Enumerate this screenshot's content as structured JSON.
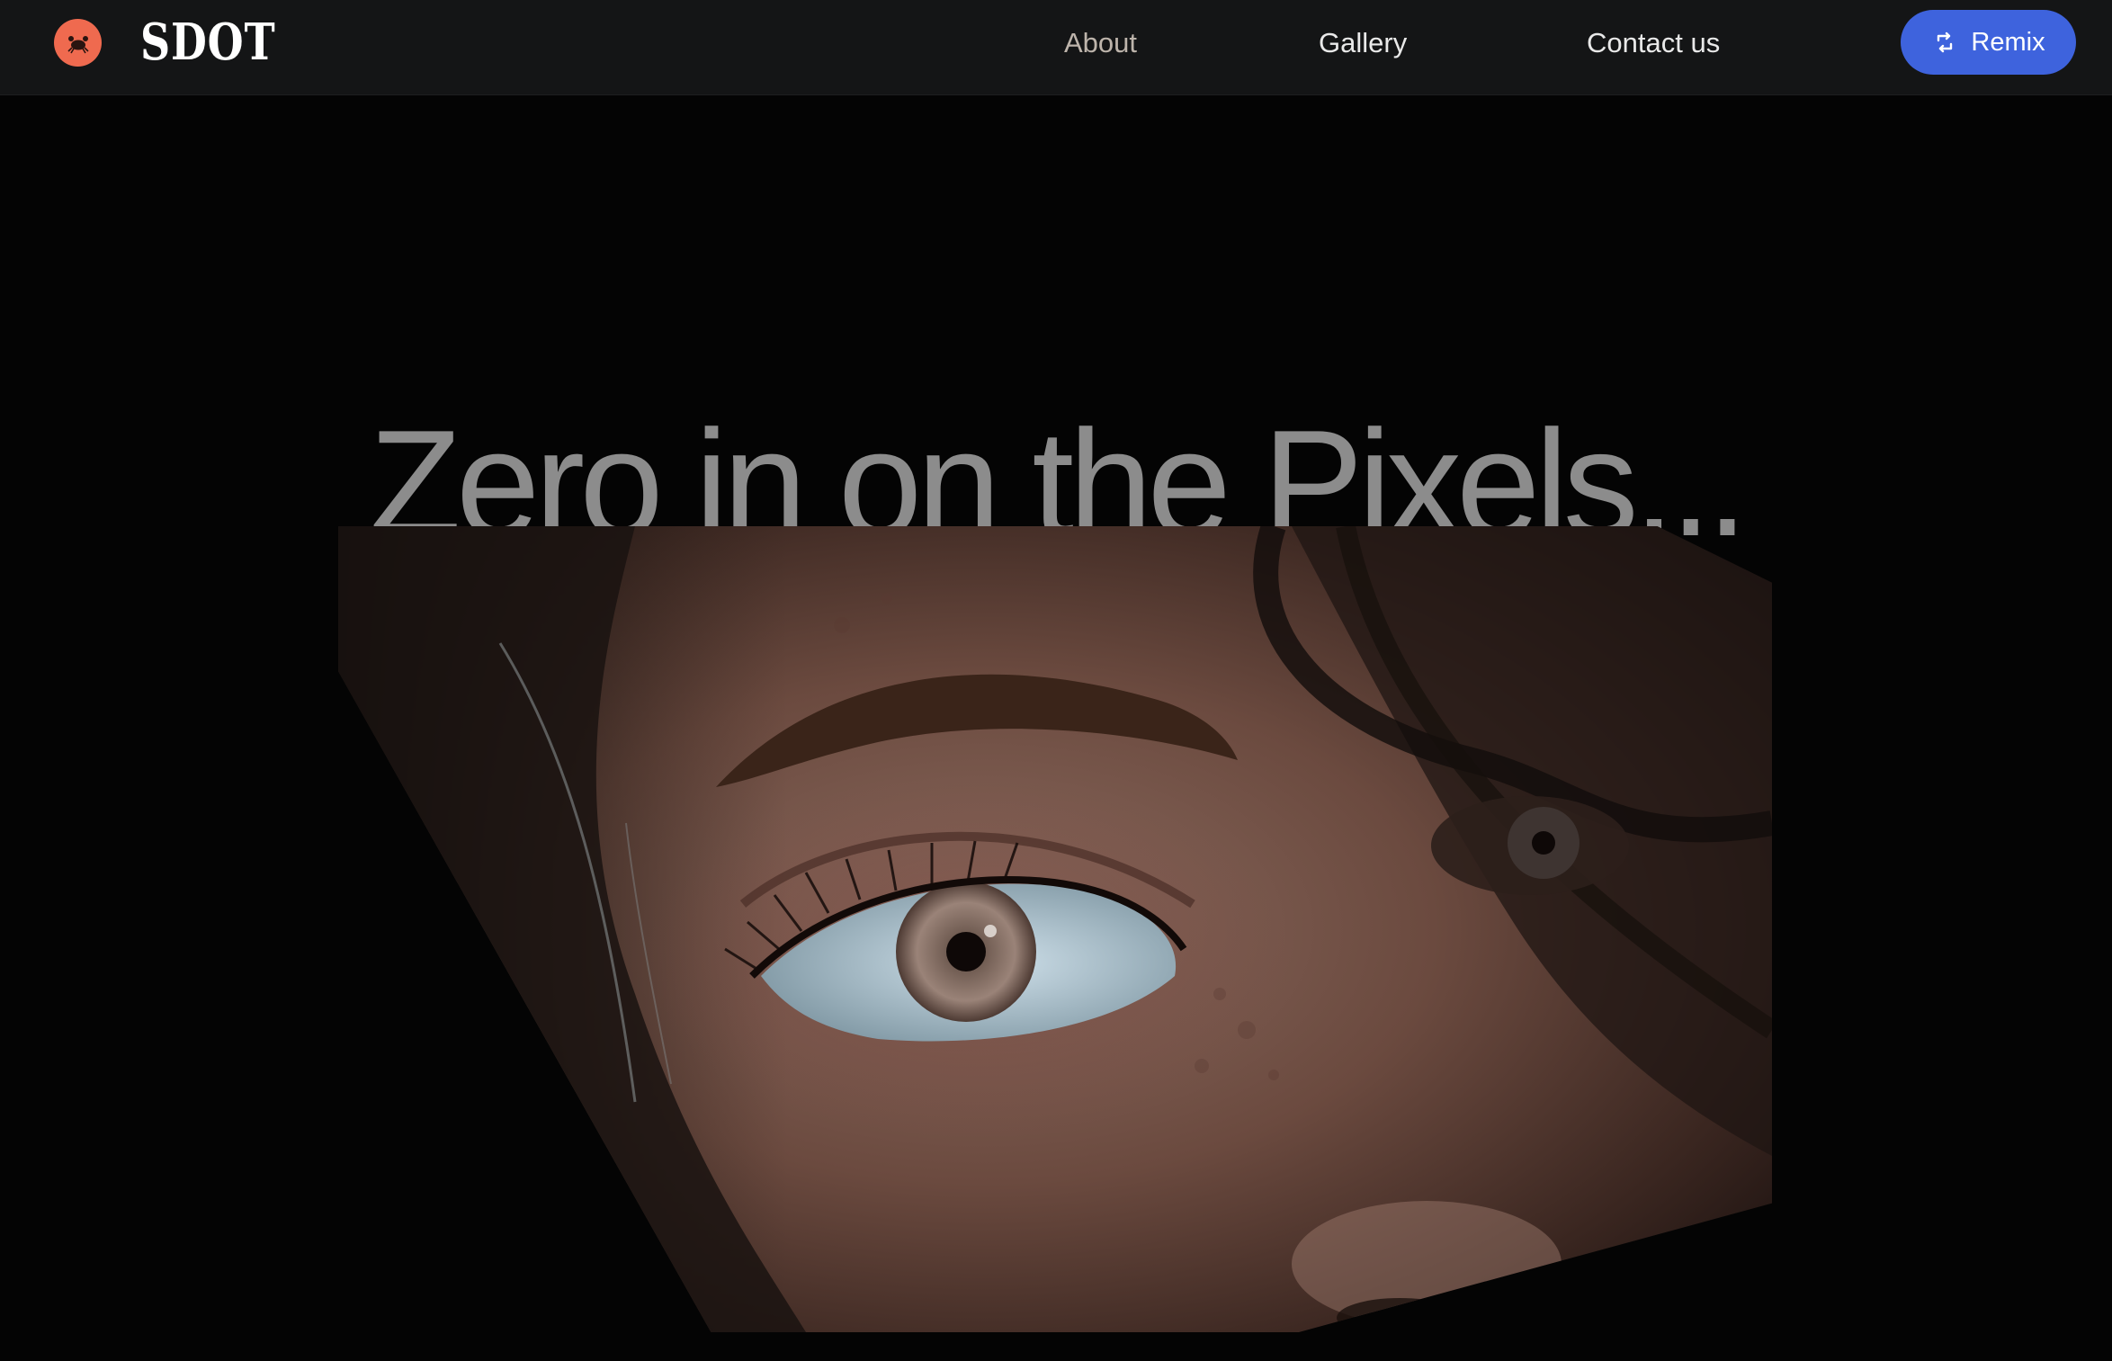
{
  "navbar": {
    "logo_icon": "crab-icon",
    "brand": "SDOT",
    "links": {
      "about": "About",
      "gallery": "Gallery",
      "contact": "Contact us"
    },
    "remix": {
      "icon": "remix-icon",
      "label": "Remix"
    }
  },
  "hero": {
    "title": "Zero in on the Pixels...",
    "image_subject": "close-up portrait of an eye"
  },
  "colors": {
    "background": "#040404",
    "navbar": "#141516",
    "accent": "#3e63dd",
    "logo": "#ef6a4f",
    "title": "#8c8c8c"
  }
}
